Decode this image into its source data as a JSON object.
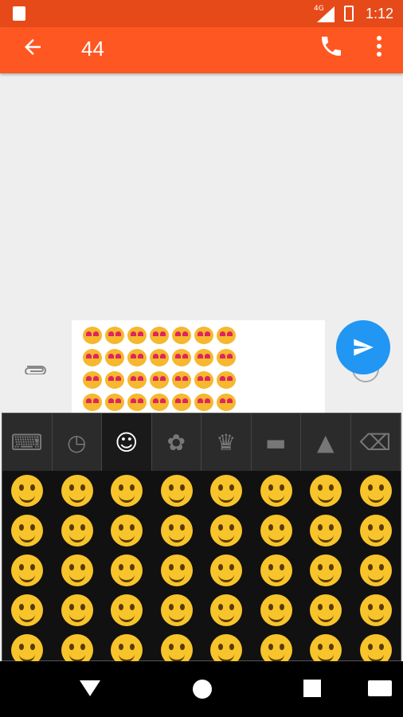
{
  "status": {
    "time": "1:12",
    "network": "4G"
  },
  "appbar": {
    "title": "44",
    "icons": [
      "back-arrow-icon",
      "phone-icon",
      "more-vert-icon"
    ]
  },
  "compose": {
    "emoji_count": 28,
    "icons": [
      "attach-icon",
      "emoji-button-icon",
      "send-icon"
    ]
  },
  "keyboard": {
    "tabs": [
      "keyboard",
      "recent",
      "smileys",
      "flower",
      "crown",
      "car",
      "triangle",
      "backspace"
    ],
    "active_tab": "smileys",
    "rows": 5,
    "cols": 8
  },
  "colors": {
    "accent": "#ff5722",
    "statusbar": "#e64a19",
    "send": "#2196f3"
  }
}
